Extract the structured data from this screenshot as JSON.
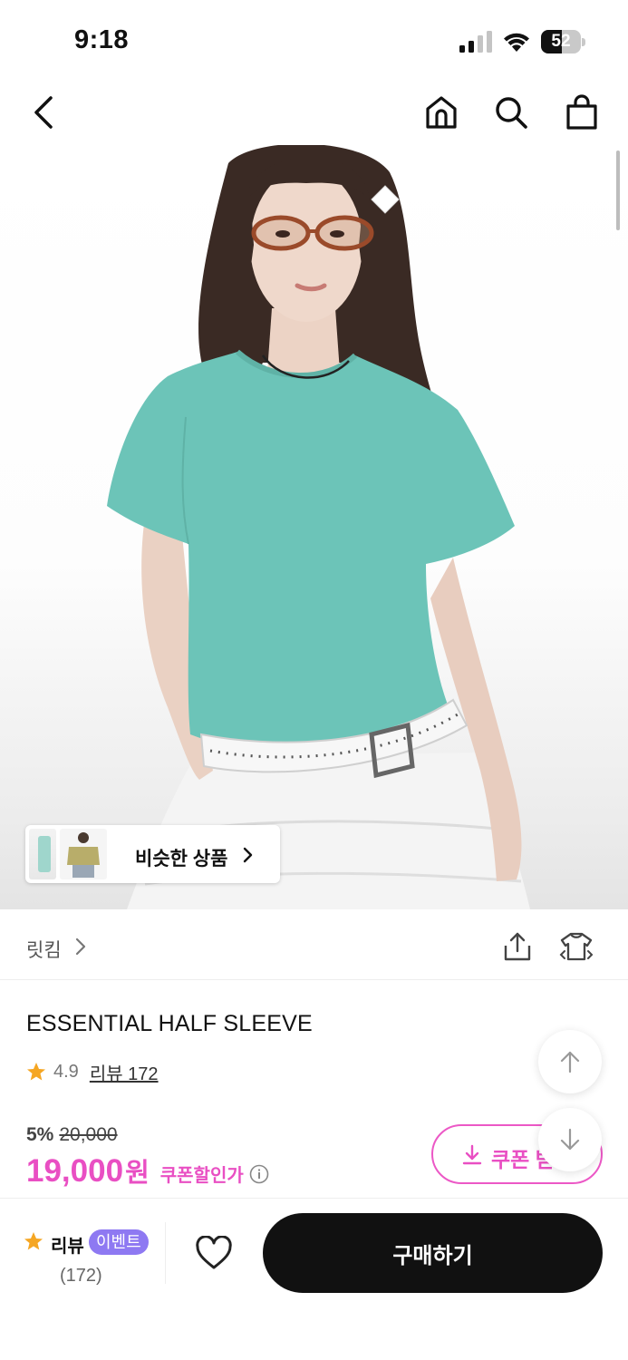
{
  "status_bar": {
    "time": "9:18",
    "battery_level": "52"
  },
  "nav": {
    "back_icon": "chevron-left-icon",
    "home_icon": "home-icon",
    "search_icon": "search-icon",
    "cart_icon": "shopping-bag-icon"
  },
  "hero": {
    "image_subject": "model wearing mint half sleeve t-shirt, white skirt and studded belt",
    "shirt_color": "#6cc4b8",
    "similar_products_label": "비슷한 상품"
  },
  "brand": {
    "name": "릿킴",
    "share_icon": "share-icon",
    "fitting_icon": "shirt-fitting-icon"
  },
  "product": {
    "title": "ESSENTIAL HALF SLEEVE",
    "rating": "4.9",
    "review_link": "리뷰 172",
    "discount_rate": "5%",
    "original_price": "20,000",
    "sale_price": "19,000",
    "price_unit": "원",
    "coupon_price_label": "쿠폰할인가",
    "coupon_button_label": "쿠폰 받",
    "accent_color": "#e94fc3"
  },
  "bottom_bar": {
    "review_label": "리뷰",
    "event_badge": "이벤트",
    "review_count": "(172)",
    "buy_label": "구매하기"
  }
}
